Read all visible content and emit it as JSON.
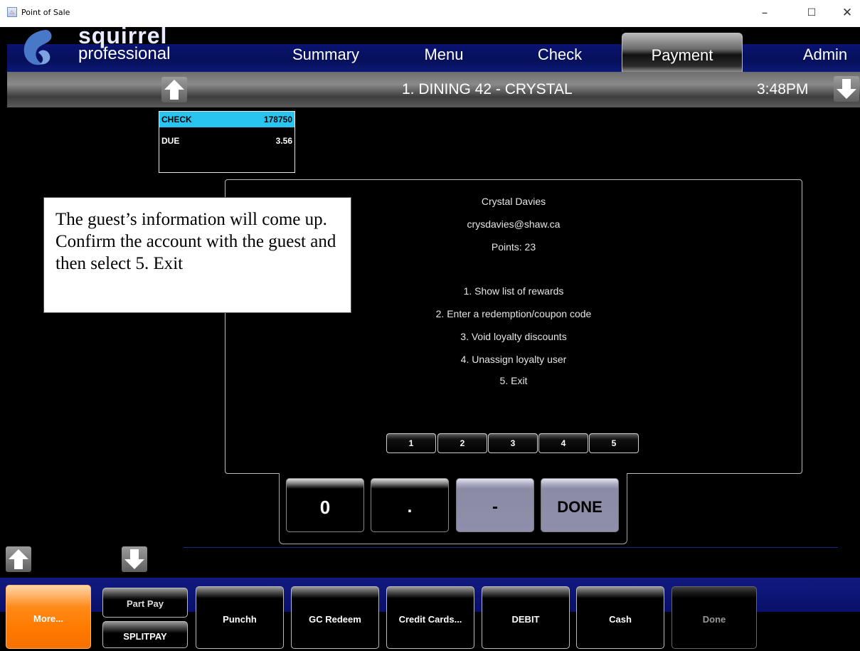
{
  "window": {
    "title": "Point of Sale",
    "controls": {
      "minimize": "–",
      "maximize": "☐",
      "close": "✕"
    }
  },
  "brand": {
    "logo_top": "squirrel",
    "logo_text": "professional",
    "colors": {
      "nav_blue": "#0a1370",
      "accent_cyan": "#29c4ef",
      "more_orange": "#ff8a1a"
    }
  },
  "nav": {
    "tabs": [
      {
        "label": "Summary"
      },
      {
        "label": "Menu"
      },
      {
        "label": "Check"
      },
      {
        "label": "Payment",
        "active": true
      },
      {
        "label": "Admin"
      }
    ]
  },
  "ribbon": {
    "title": "1. DINING 42 - CRYSTAL",
    "time": "3:48PM",
    "icons": [
      "arrow-up-icon",
      "arrow-down-icon"
    ]
  },
  "check_panel": {
    "check_label": "CHECK",
    "check_value": "178750",
    "due_label": "DUE",
    "due_value": "3.56"
  },
  "dialog": {
    "name": "Crystal Davies",
    "email": "crysdavies@shaw.ca",
    "points": "Points: 23",
    "options": [
      "1. Show list of rewards",
      "2. Enter a redemption/coupon code",
      "3. Void loyalty discounts",
      "4. Unassign loyalty user",
      "5. Exit"
    ],
    "number_buttons": [
      "1",
      "2",
      "3",
      "4",
      "5"
    ]
  },
  "callout": {
    "text": "The guest’s information will come up. Confirm the account with the guest and then select 5. Exit"
  },
  "keypad": {
    "keys": [
      "0",
      ".",
      "-",
      "DONE"
    ]
  },
  "toolbar": {
    "more": "More...",
    "part_pay": "Part Pay",
    "splitpay": "SPLITPAY",
    "punchh": "Punchh",
    "gc_redeem": "GC Redeem",
    "credit_cards": "Credit Cards...",
    "debit": "DEBIT",
    "cash": "Cash",
    "done": "Done"
  }
}
